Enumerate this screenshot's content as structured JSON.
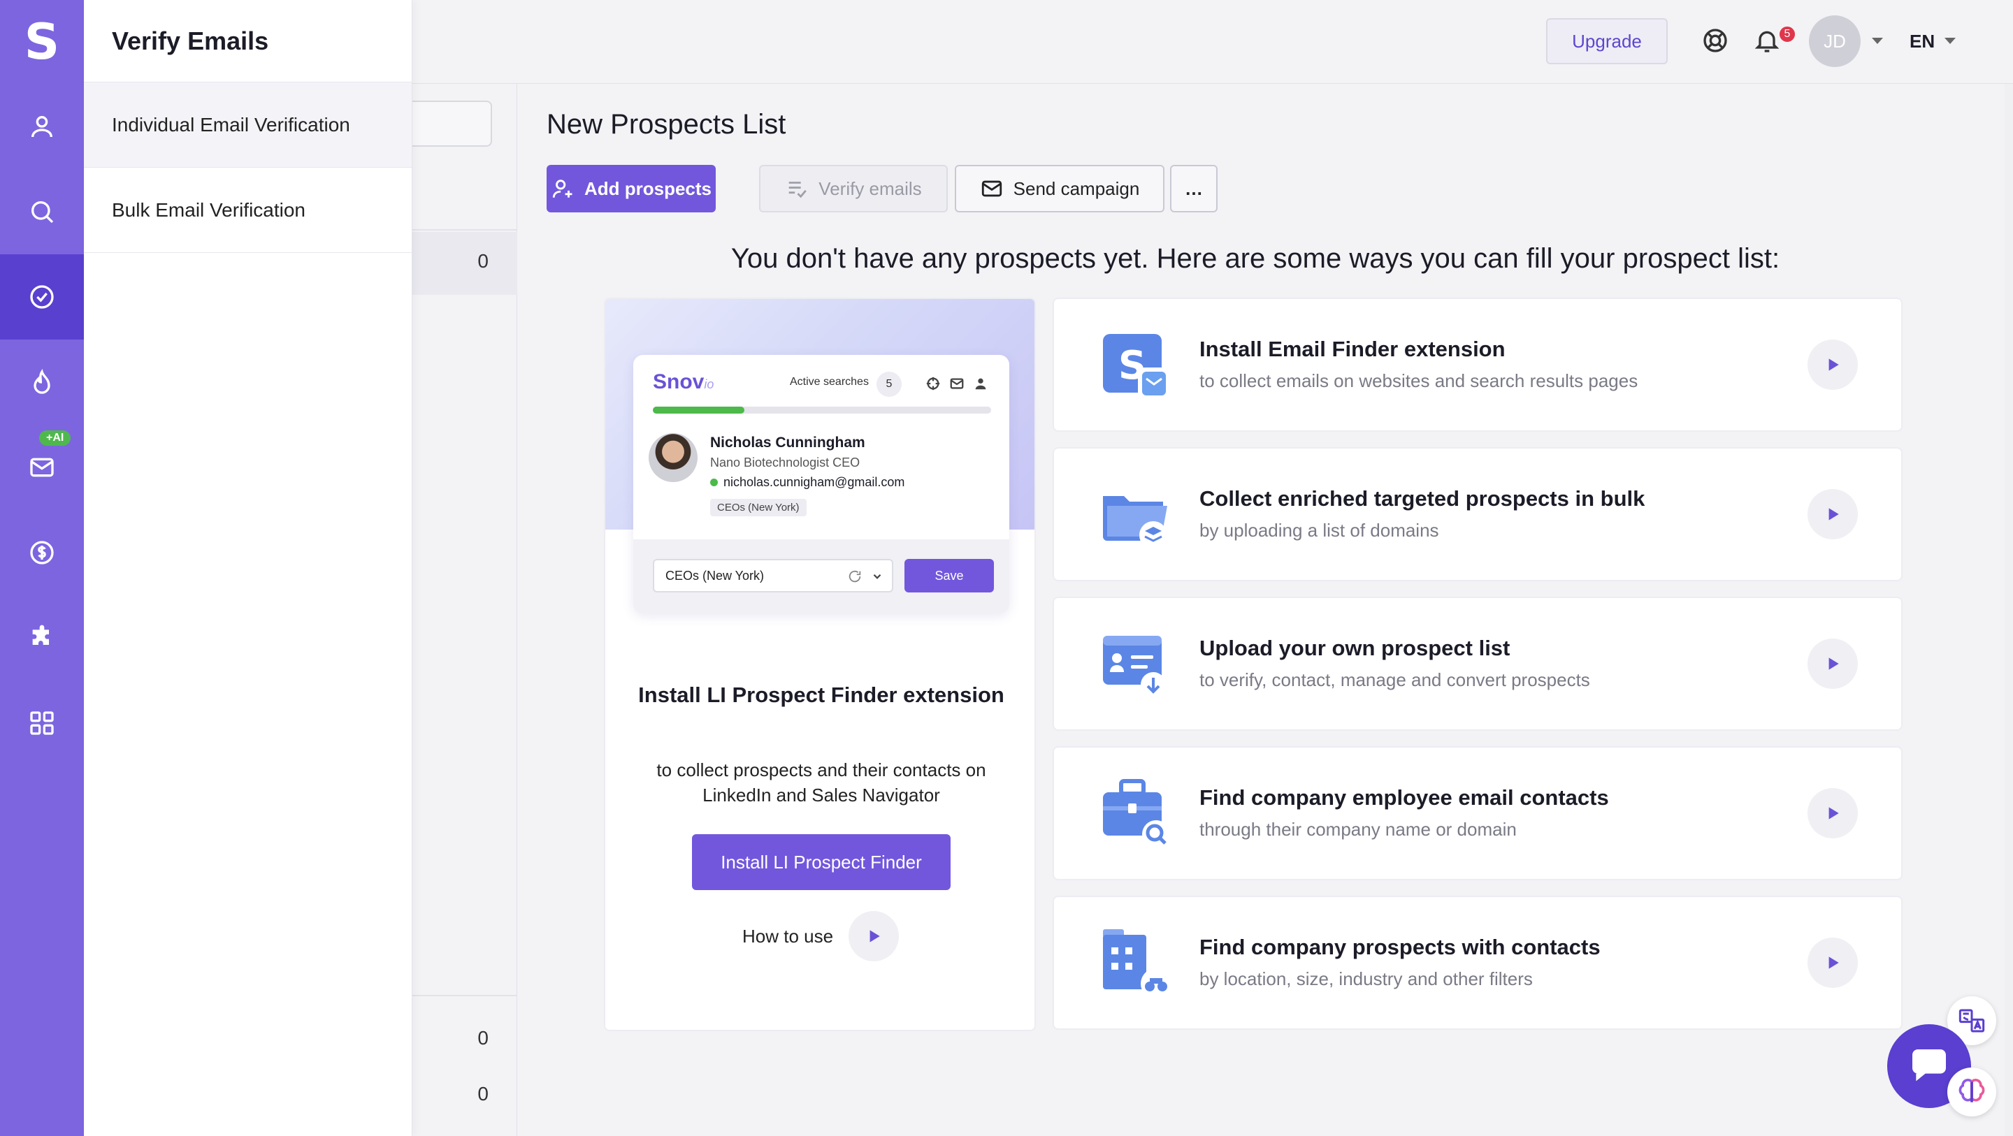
{
  "app": {
    "logo_letter": "S",
    "brand_color": "#7d65e0",
    "accent_color": "#7257dc"
  },
  "rail": {
    "items": [
      {
        "icon": "user-icon",
        "active": false
      },
      {
        "icon": "search-icon",
        "active": false
      },
      {
        "icon": "check-circle-icon",
        "active": true
      },
      {
        "icon": "flame-icon",
        "active": false
      },
      {
        "icon": "mail-icon",
        "active": false,
        "badge": "+AI"
      },
      {
        "icon": "dollar-icon",
        "active": false
      },
      {
        "icon": "puzzle-icon",
        "active": false
      },
      {
        "icon": "apps-grid-icon",
        "active": false
      }
    ]
  },
  "flyout": {
    "title": "Verify Emails",
    "options": [
      {
        "label": "Individual Email Verification"
      },
      {
        "label": "Bulk Email Verification"
      }
    ]
  },
  "lists_panel": {
    "counts": [
      "0",
      "0",
      "0"
    ]
  },
  "topbar": {
    "upgrade_label": "Upgrade",
    "notifications_count": "5",
    "avatar_initials": "JD",
    "language": "EN"
  },
  "main": {
    "title": "New Prospects List",
    "actions": {
      "add_prospects": "Add prospects",
      "verify_emails": "Verify emails",
      "send_campaign": "Send campaign",
      "more": "…"
    },
    "empty_message": "You don't have any prospects yet. Here are some ways you can fill your prospect list:",
    "promo": {
      "title": "Install LI Prospect Finder extension",
      "description": "to collect prospects and their contacts on LinkedIn and Sales Navigator",
      "button": "Install LI Prospect Finder",
      "how_to_use": "How to use",
      "mock": {
        "logo_text": "Snov",
        "logo_suffix": "io",
        "active_searches_label": "Active searches",
        "active_searches_count": "5",
        "progress_fraction": 0.27,
        "person_name": "Nicholas Cunningham",
        "person_role": "Nano Biotechnologist CEO",
        "person_email": "nicholas.cunnigham@gmail.com",
        "person_tag": "CEOs (New York)",
        "list_select": "CEOs (New York)",
        "save_label": "Save"
      }
    },
    "options": [
      {
        "title": "Install Email Finder extension",
        "description": "to collect emails on websites and search results pages",
        "icon": "email-finder-extension-icon"
      },
      {
        "title": "Collect enriched targeted prospects in bulk",
        "description": "by uploading a list of domains",
        "icon": "folder-layers-icon"
      },
      {
        "title": "Upload your own prospect list",
        "description": "to verify, contact, manage and convert prospects",
        "icon": "contact-card-upload-icon"
      },
      {
        "title": "Find company employee email contacts",
        "description": "through their company name or domain",
        "icon": "briefcase-search-icon"
      },
      {
        "title": "Find company prospects with contacts",
        "description": "by location, size, industry and other filters",
        "icon": "building-binoculars-icon"
      }
    ]
  }
}
